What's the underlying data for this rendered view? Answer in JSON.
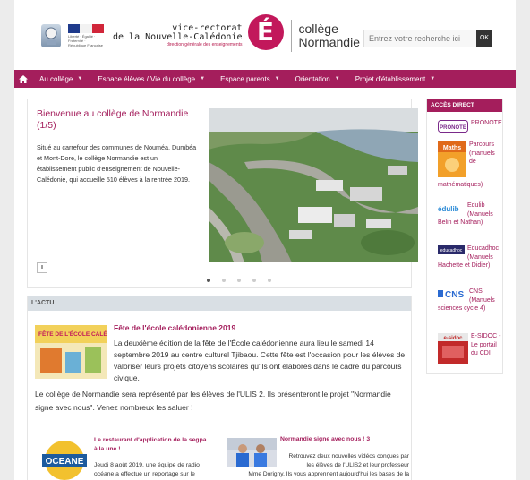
{
  "header": {
    "vice_rectorat_line1": "vice-rectorat",
    "vice_rectorat_line2": "de la Nouvelle-Calédonie",
    "vice_rectorat_line3": "direction générale des enseignements",
    "logo_letter": "É",
    "college_line1": "collège",
    "college_line2": "Normandie",
    "search_placeholder": "Entrez votre recherche ici",
    "search_button": "OK",
    "flag_caption": "Liberté · Égalité · Fraternité · République Française"
  },
  "nav": {
    "items": [
      {
        "label": "Au collège"
      },
      {
        "label": "Espace élèves / Vie du collège"
      },
      {
        "label": "Espace parents"
      },
      {
        "label": "Orientation"
      },
      {
        "label": "Projet d'établissement"
      }
    ]
  },
  "slider": {
    "title": "Bienvenue au collège de Normandie (1/5)",
    "text": "Situé au carrefour des communes de Nouméa, Dumbéa et Mont-Dore, le collège Normandie est un établissement public d'enseignement de Nouvelle-Calédonie, qui accueille 510 élèves à la rentrée 2019.",
    "pause_label": "II",
    "active_dot": 1,
    "dot_count": 5
  },
  "actu": {
    "heading": "L'ACTU",
    "article1": {
      "thumb_text": "FÊTE DE L'ÉCOLE CALÉDONIENNE",
      "title": "Fête de l'école calédonienne 2019",
      "text": "La deuxième édition de la fête de l'École calédonienne aura lieu le samedi 14 septembre 2019 au centre culturel Tjibaou. Cette fête est l'occasion pour les élèves de valoriser leurs projets citoyens scolaires qu'ils ont élaborés dans le cadre du parcours civique.",
      "text2": "Le collège de Normandie sera représenté par les élèves de l'ULIS 2. Ils présenteront le projet \"Normandie signe avec nous\". Venez nombreux les saluer !"
    },
    "article2": {
      "thumb_text": "OCEANE",
      "title": "Le restaurant d'application de la segpa à la une !",
      "text": "Jeudi 8 août 2019, une équipe de radio océane a effectué un reportage sur le"
    },
    "article3": {
      "title": "Normandie signe avec nous ! 3",
      "text": "Retrouvez deux nouvelles vidéos conçues par les élèves de l'ULIS2 et leur professeur",
      "text2": "Mme Dorigny. Ils vous apprennent aujourd'hui les bases de la"
    }
  },
  "sidebar": {
    "heading": "ACCÈS DIRECT",
    "items": [
      {
        "label": "PRONOTE",
        "logo_text": "PRONOTE"
      },
      {
        "label": "Parcours (manuels de mathématiques)",
        "logo_text": "Maths"
      },
      {
        "label": "Edulib (Manuels Belin et Nathan)",
        "logo_text": "édulib"
      },
      {
        "label": "Educadhoc (Manuels Hachette et Didier)",
        "logo_text": "educadhoc"
      },
      {
        "label": "CNS (Manuels sciences cycle 4)",
        "logo_text": "CNS"
      },
      {
        "label": "E-SIDOC - Le portail du CDI",
        "logo_text": "e-sidoc"
      }
    ]
  },
  "colors": {
    "brand": "#a41e5c",
    "nav_background": "#a41e5c",
    "actu_bar": "#d9dfe4"
  }
}
